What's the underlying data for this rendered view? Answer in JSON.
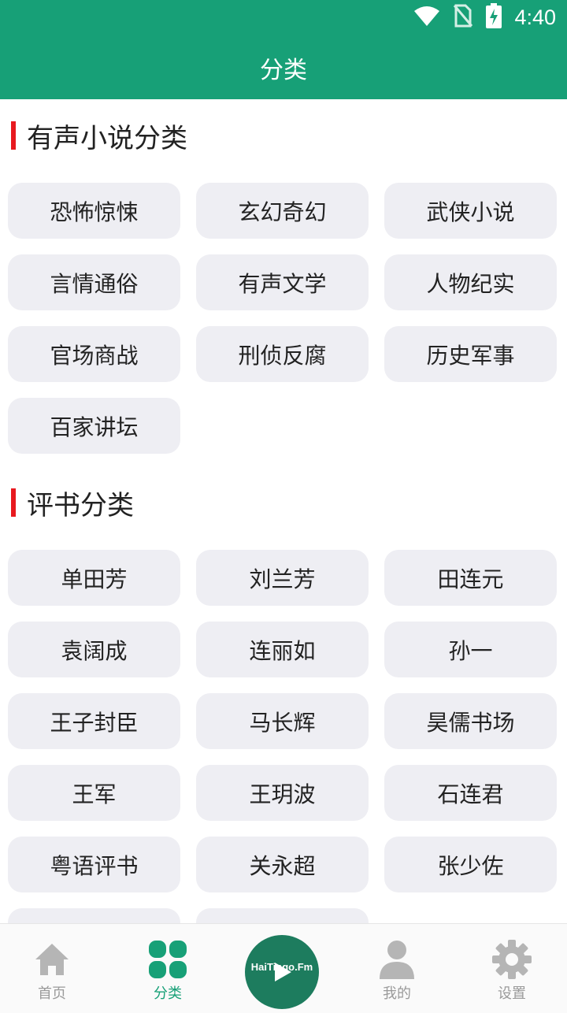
{
  "status_bar": {
    "time": "4:40"
  },
  "header": {
    "title": "分类"
  },
  "sections": [
    {
      "title": "有声小说分类",
      "items": [
        "恐怖惊悚",
        "玄幻奇幻",
        "武侠小说",
        "言情通俗",
        "有声文学",
        "人物纪实",
        "官场商战",
        "刑侦反腐",
        "历史军事",
        "百家讲坛"
      ]
    },
    {
      "title": "评书分类",
      "items": [
        "单田芳",
        "刘兰芳",
        "田连元",
        "袁阔成",
        "连丽如",
        "孙一",
        "王子封臣",
        "马长辉",
        "昊儒书场",
        "王军",
        "王玥波",
        "石连君",
        "粤语评书",
        "关永超",
        "张少佐"
      ]
    }
  ],
  "tabbar": {
    "home": "首页",
    "category": "分类",
    "player_brand": "HaiTingo.Fm",
    "mine": "我的",
    "settings": "设置"
  },
  "colors": {
    "primary": "#17a077",
    "accent_bar": "#e8191f",
    "chip_bg": "#eeeef3",
    "tab_inactive": "#9a9a9a"
  }
}
